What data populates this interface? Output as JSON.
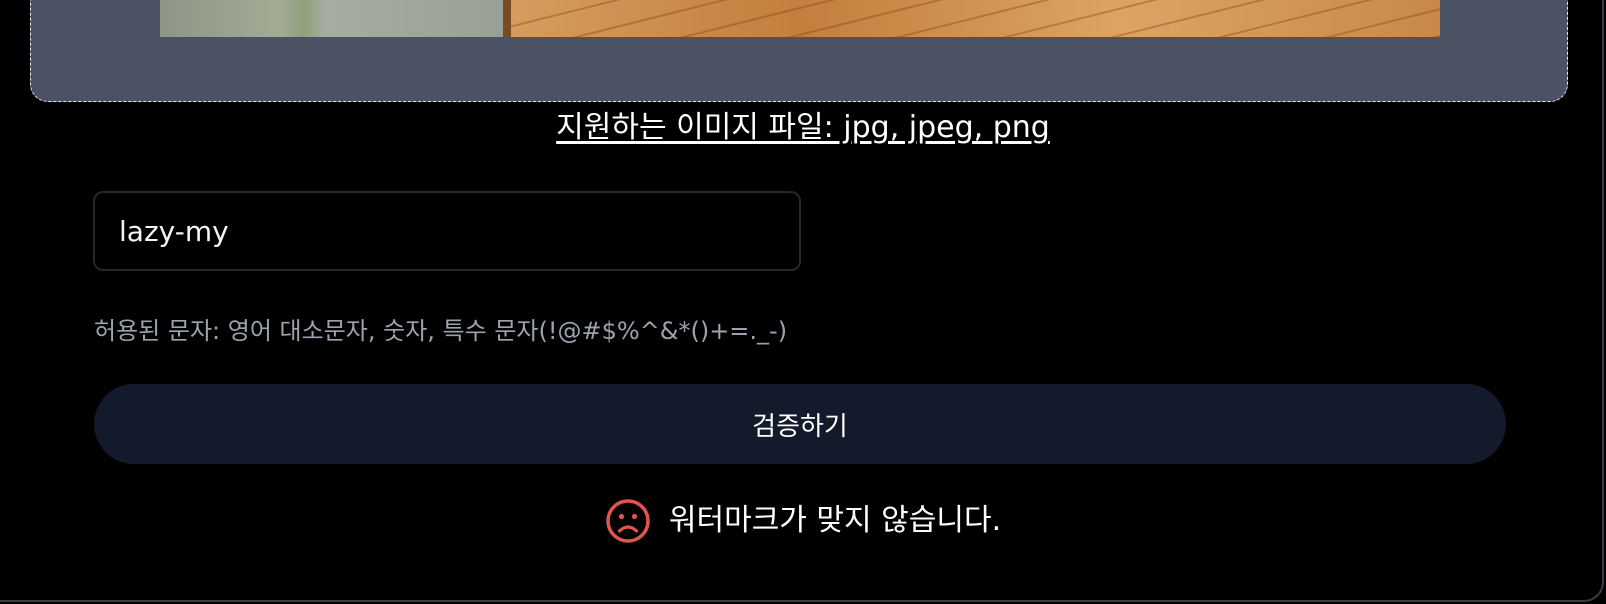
{
  "upload": {
    "supported_formats": "지원하는 이미지 파일: jpg, jpeg, png"
  },
  "watermark_input": {
    "value": "lazy-my"
  },
  "hint": {
    "text": "허용된 문자: 영어 대소문자, 숫자, 특수 문자(!@#$%^&*()+=._-)"
  },
  "verify_button": {
    "label": "검증하기"
  },
  "result": {
    "icon": "sad-face-icon",
    "message": "워터마크가 맞지 않습니다.",
    "color": "#e0554c"
  },
  "colors": {
    "background": "#000000",
    "dropzone": "#4b5263",
    "button": "#131a2b",
    "hint": "#9ca3af",
    "error": "#e0554c"
  }
}
